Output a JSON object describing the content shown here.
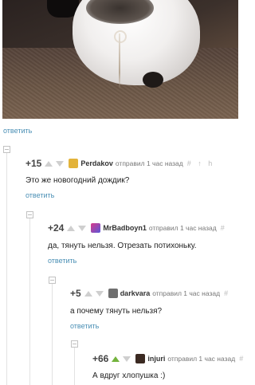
{
  "post": {
    "reply_link": "ответить"
  },
  "comments": [
    {
      "score": "+15",
      "user": "Perdakov",
      "meta": "отправил 1 час назад",
      "tools": "# ↑ h",
      "text": "Это же новогодний дождик?",
      "reply": "ответить",
      "avatar_color": "#e3b33a"
    },
    {
      "score": "+24",
      "user": "MrBadboyn1",
      "meta": "отправил 1 час назад",
      "tools": "#",
      "text": "да, тянуть нельзя. Отрезать потихоньку.",
      "reply": "ответить",
      "avatar_color": "#8e49b7"
    },
    {
      "score": "+5",
      "user": "darkvara",
      "meta": "отправил 1 час назад",
      "tools": "#",
      "text": "а почему тянуть нельзя?",
      "reply": "ответить",
      "avatar_color": "#6f6f6f"
    },
    {
      "score": "+66",
      "user": "injuri",
      "meta": "отправил 1 час назад",
      "tools": "#",
      "text": "А вдруг хлопушка :)",
      "avatar_color": "#3b2a22"
    }
  ],
  "colors": {
    "link": "#4a8fb5",
    "vote_up_active": "#73b33c",
    "vote_inactive": "#cfcfcf"
  }
}
